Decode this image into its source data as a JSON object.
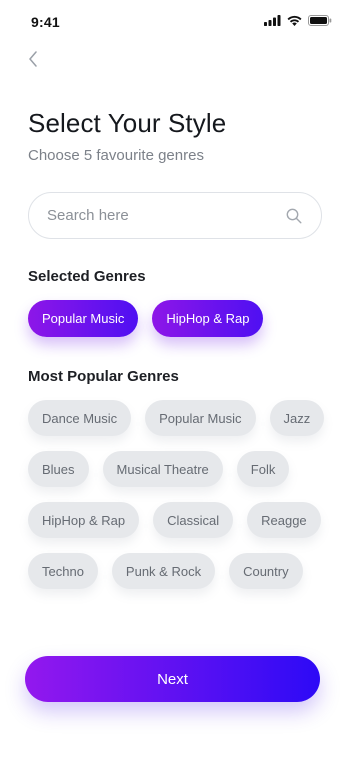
{
  "status_bar": {
    "time": "9:41",
    "icons": [
      "cellular-signal-icon",
      "wifi-icon",
      "battery-icon"
    ]
  },
  "header": {
    "back_icon": "chevron-left-icon",
    "title": "Select Your Style",
    "subtitle": "Choose 5 favourite genres"
  },
  "search": {
    "placeholder": "Search here",
    "icon": "search-icon"
  },
  "selected_section": {
    "title": "Selected Genres",
    "chips": [
      {
        "label": "Popular Music"
      },
      {
        "label": "HipHop & Rap"
      }
    ]
  },
  "popular_section": {
    "title": "Most Popular Genres",
    "rows": [
      [
        {
          "label": "Dance Music"
        },
        {
          "label": "Popular Music"
        },
        {
          "label": "Jazz"
        }
      ],
      [
        {
          "label": "Blues"
        },
        {
          "label": "Musical Theatre"
        },
        {
          "label": "Folk"
        }
      ],
      [
        {
          "label": "HipHop & Rap"
        },
        {
          "label": "Classical"
        },
        {
          "label": "Reagge"
        }
      ],
      [
        {
          "label": "Techno"
        },
        {
          "label": "Punk & Rock"
        },
        {
          "label": "Country"
        }
      ]
    ]
  },
  "next_button": {
    "label": "Next"
  },
  "colors": {
    "gradient_start": "#8d16e8",
    "gradient_end": "#2d0af6",
    "chip_background": "#e6e8eb",
    "chip_text": "#666b73",
    "title_text": "#15181d",
    "subtitle_text": "#7c8189"
  }
}
